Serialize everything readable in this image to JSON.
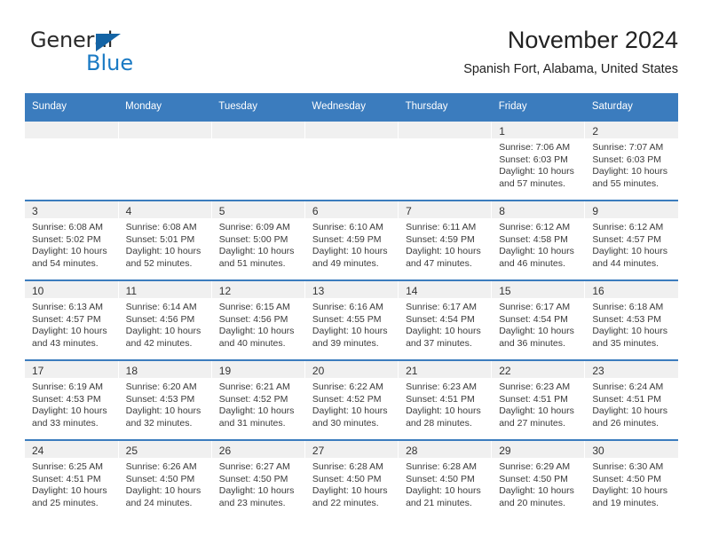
{
  "brand": {
    "name_top": "General",
    "name_bottom": "Blue",
    "logo_icon": "blue-triangle-icon",
    "color_blue": "#1a7ac4",
    "color_triangle": "#1464a5"
  },
  "header": {
    "title": "November 2024",
    "subtitle": "Spanish Fort, Alabama, United States"
  },
  "theme": {
    "header_row_bg": "#3b7cbe",
    "daynum_band_bg": "#f0f0f0",
    "row_divider": "#3b7cbe"
  },
  "calendar": {
    "weekday_headers": [
      "Sunday",
      "Monday",
      "Tuesday",
      "Wednesday",
      "Thursday",
      "Friday",
      "Saturday"
    ],
    "weeks": [
      [
        {
          "day": "",
          "lines": []
        },
        {
          "day": "",
          "lines": []
        },
        {
          "day": "",
          "lines": []
        },
        {
          "day": "",
          "lines": []
        },
        {
          "day": "",
          "lines": []
        },
        {
          "day": "1",
          "lines": [
            "Sunrise: 7:06 AM",
            "Sunset: 6:03 PM",
            "Daylight: 10 hours",
            "and 57 minutes."
          ]
        },
        {
          "day": "2",
          "lines": [
            "Sunrise: 7:07 AM",
            "Sunset: 6:03 PM",
            "Daylight: 10 hours",
            "and 55 minutes."
          ]
        }
      ],
      [
        {
          "day": "3",
          "lines": [
            "Sunrise: 6:08 AM",
            "Sunset: 5:02 PM",
            "Daylight: 10 hours",
            "and 54 minutes."
          ]
        },
        {
          "day": "4",
          "lines": [
            "Sunrise: 6:08 AM",
            "Sunset: 5:01 PM",
            "Daylight: 10 hours",
            "and 52 minutes."
          ]
        },
        {
          "day": "5",
          "lines": [
            "Sunrise: 6:09 AM",
            "Sunset: 5:00 PM",
            "Daylight: 10 hours",
            "and 51 minutes."
          ]
        },
        {
          "day": "6",
          "lines": [
            "Sunrise: 6:10 AM",
            "Sunset: 4:59 PM",
            "Daylight: 10 hours",
            "and 49 minutes."
          ]
        },
        {
          "day": "7",
          "lines": [
            "Sunrise: 6:11 AM",
            "Sunset: 4:59 PM",
            "Daylight: 10 hours",
            "and 47 minutes."
          ]
        },
        {
          "day": "8",
          "lines": [
            "Sunrise: 6:12 AM",
            "Sunset: 4:58 PM",
            "Daylight: 10 hours",
            "and 46 minutes."
          ]
        },
        {
          "day": "9",
          "lines": [
            "Sunrise: 6:12 AM",
            "Sunset: 4:57 PM",
            "Daylight: 10 hours",
            "and 44 minutes."
          ]
        }
      ],
      [
        {
          "day": "10",
          "lines": [
            "Sunrise: 6:13 AM",
            "Sunset: 4:57 PM",
            "Daylight: 10 hours",
            "and 43 minutes."
          ]
        },
        {
          "day": "11",
          "lines": [
            "Sunrise: 6:14 AM",
            "Sunset: 4:56 PM",
            "Daylight: 10 hours",
            "and 42 minutes."
          ]
        },
        {
          "day": "12",
          "lines": [
            "Sunrise: 6:15 AM",
            "Sunset: 4:56 PM",
            "Daylight: 10 hours",
            "and 40 minutes."
          ]
        },
        {
          "day": "13",
          "lines": [
            "Sunrise: 6:16 AM",
            "Sunset: 4:55 PM",
            "Daylight: 10 hours",
            "and 39 minutes."
          ]
        },
        {
          "day": "14",
          "lines": [
            "Sunrise: 6:17 AM",
            "Sunset: 4:54 PM",
            "Daylight: 10 hours",
            "and 37 minutes."
          ]
        },
        {
          "day": "15",
          "lines": [
            "Sunrise: 6:17 AM",
            "Sunset: 4:54 PM",
            "Daylight: 10 hours",
            "and 36 minutes."
          ]
        },
        {
          "day": "16",
          "lines": [
            "Sunrise: 6:18 AM",
            "Sunset: 4:53 PM",
            "Daylight: 10 hours",
            "and 35 minutes."
          ]
        }
      ],
      [
        {
          "day": "17",
          "lines": [
            "Sunrise: 6:19 AM",
            "Sunset: 4:53 PM",
            "Daylight: 10 hours",
            "and 33 minutes."
          ]
        },
        {
          "day": "18",
          "lines": [
            "Sunrise: 6:20 AM",
            "Sunset: 4:53 PM",
            "Daylight: 10 hours",
            "and 32 minutes."
          ]
        },
        {
          "day": "19",
          "lines": [
            "Sunrise: 6:21 AM",
            "Sunset: 4:52 PM",
            "Daylight: 10 hours",
            "and 31 minutes."
          ]
        },
        {
          "day": "20",
          "lines": [
            "Sunrise: 6:22 AM",
            "Sunset: 4:52 PM",
            "Daylight: 10 hours",
            "and 30 minutes."
          ]
        },
        {
          "day": "21",
          "lines": [
            "Sunrise: 6:23 AM",
            "Sunset: 4:51 PM",
            "Daylight: 10 hours",
            "and 28 minutes."
          ]
        },
        {
          "day": "22",
          "lines": [
            "Sunrise: 6:23 AM",
            "Sunset: 4:51 PM",
            "Daylight: 10 hours",
            "and 27 minutes."
          ]
        },
        {
          "day": "23",
          "lines": [
            "Sunrise: 6:24 AM",
            "Sunset: 4:51 PM",
            "Daylight: 10 hours",
            "and 26 minutes."
          ]
        }
      ],
      [
        {
          "day": "24",
          "lines": [
            "Sunrise: 6:25 AM",
            "Sunset: 4:51 PM",
            "Daylight: 10 hours",
            "and 25 minutes."
          ]
        },
        {
          "day": "25",
          "lines": [
            "Sunrise: 6:26 AM",
            "Sunset: 4:50 PM",
            "Daylight: 10 hours",
            "and 24 minutes."
          ]
        },
        {
          "day": "26",
          "lines": [
            "Sunrise: 6:27 AM",
            "Sunset: 4:50 PM",
            "Daylight: 10 hours",
            "and 23 minutes."
          ]
        },
        {
          "day": "27",
          "lines": [
            "Sunrise: 6:28 AM",
            "Sunset: 4:50 PM",
            "Daylight: 10 hours",
            "and 22 minutes."
          ]
        },
        {
          "day": "28",
          "lines": [
            "Sunrise: 6:28 AM",
            "Sunset: 4:50 PM",
            "Daylight: 10 hours",
            "and 21 minutes."
          ]
        },
        {
          "day": "29",
          "lines": [
            "Sunrise: 6:29 AM",
            "Sunset: 4:50 PM",
            "Daylight: 10 hours",
            "and 20 minutes."
          ]
        },
        {
          "day": "30",
          "lines": [
            "Sunrise: 6:30 AM",
            "Sunset: 4:50 PM",
            "Daylight: 10 hours",
            "and 19 minutes."
          ]
        }
      ]
    ]
  }
}
